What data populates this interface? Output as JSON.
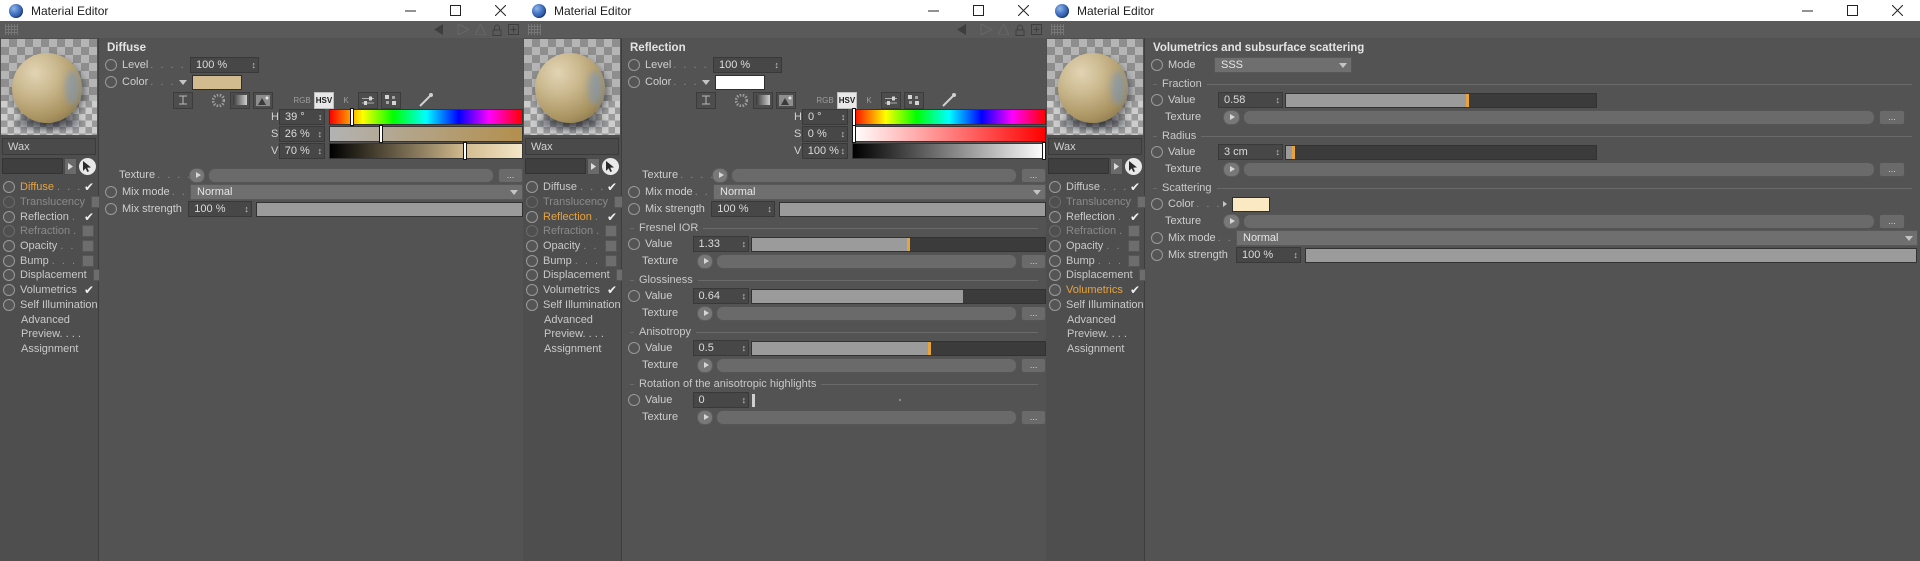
{
  "app": {
    "title": "Material Editor"
  },
  "window_controls": {
    "minimize": "minimize-icon",
    "maximize": "maximize-icon",
    "close": "close-icon"
  },
  "material": {
    "name": "Wax"
  },
  "channels": [
    {
      "label": "Diffuse",
      "dots": ". . . . . . . .",
      "checked": true,
      "enabled": true,
      "active": false
    },
    {
      "label": "Translucency",
      "dots": ". . .",
      "checked": false,
      "enabled": false,
      "active": false
    },
    {
      "label": "Reflection",
      "dots": ". . . . .",
      "checked": true,
      "enabled": true,
      "active": false
    },
    {
      "label": "Refraction",
      "dots": ". . . . .",
      "checked": false,
      "enabled": false,
      "active": false
    },
    {
      "label": "Opacity",
      "dots": ". . . . . . . .",
      "checked": false,
      "enabled": true,
      "active": false
    },
    {
      "label": "Bump",
      "dots": ". . . . . . . .",
      "checked": false,
      "enabled": true,
      "active": false
    },
    {
      "label": "Displacement",
      "dots": ". . .",
      "checked": false,
      "enabled": true,
      "active": false
    },
    {
      "label": "Volumetrics",
      "dots": ". . . .",
      "checked": true,
      "enabled": true,
      "active": false
    },
    {
      "label": "Self Illumination",
      "dots": "",
      "checked": false,
      "enabled": true,
      "active": false
    }
  ],
  "extra_items": [
    "Advanced",
    "Preview. . . .",
    "Assignment"
  ],
  "panels": {
    "diffuse": {
      "active_channel": "Diffuse",
      "section_title": "Diffuse",
      "level": {
        "label": "Level",
        "dots": ". . . . . . .",
        "value": "100 %"
      },
      "color": {
        "label": "Color",
        "dots": ". . .",
        "swatch": "#d2bb8e"
      },
      "color_mode": {
        "rgb": "RGB",
        "hsv": "HSV",
        "k": "K",
        "selected": "HSV"
      },
      "hsv": [
        {
          "label": "H",
          "value": "39 °",
          "pos_pct": 11
        },
        {
          "label": "S",
          "value": "26 %",
          "pos_pct": 26
        },
        {
          "label": "V",
          "value": "70 %",
          "pos_pct": 70
        }
      ],
      "texture": {
        "label": "Texture",
        "dots": ". . . . ."
      },
      "mix_mode": {
        "label": "Mix mode",
        "dots": ". . .",
        "value": "Normal"
      },
      "mix_strength": {
        "label": "Mix strength",
        "value": "100 %",
        "fill_pct": 100
      }
    },
    "reflection": {
      "active_channel": "Reflection",
      "section_title": "Reflection",
      "level": {
        "label": "Level",
        "dots": ". . . . . . .",
        "value": "100 %"
      },
      "color": {
        "label": "Color",
        "dots": ". . .",
        "swatch": "#ffffff"
      },
      "color_mode": {
        "rgb": "RGB",
        "hsv": "HSV",
        "k": "K",
        "selected": "HSV"
      },
      "hsv": [
        {
          "label": "H",
          "value": "0 °",
          "pos_pct": 0
        },
        {
          "label": "S",
          "value": "0 %",
          "pos_pct": 0
        },
        {
          "label": "V",
          "value": "100 %",
          "pos_pct": 100
        }
      ],
      "texture": {
        "label": "Texture",
        "dots": ". . . . ."
      },
      "mix_mode": {
        "label": "Mix mode",
        "dots": ". . .",
        "value": "Normal"
      },
      "mix_strength": {
        "label": "Mix strength",
        "value": "100 %",
        "fill_pct": 100
      },
      "groups": [
        {
          "title": "Fresnel IOR",
          "value_label": "Value",
          "value": "1.33",
          "fill_pct": 53,
          "texture_label": "Texture"
        },
        {
          "title": "Glossiness",
          "value_label": "Value",
          "value": "0.64",
          "fill_pct": 72,
          "texture_label": "Texture"
        },
        {
          "title": "Anisotropy",
          "value_label": "Value",
          "value": "0.5",
          "fill_pct": 60,
          "texture_label": "Texture"
        },
        {
          "title": "Rotation of the anisotropic highlights",
          "value_label": "Value",
          "value": "0",
          "fill_pct": 0,
          "texture_label": "Texture"
        }
      ]
    },
    "volumetrics": {
      "active_channel": "Volumetrics",
      "section_title": "Volumetrics and subsurface scattering",
      "mode": {
        "label": "Mode",
        "value": "SSS"
      },
      "fraction": {
        "title": "Fraction",
        "value_label": "Value",
        "value": "0.58",
        "fill_pct": 58,
        "texture_label": "Texture"
      },
      "radius": {
        "title": "Radius",
        "value_label": "Value",
        "value": "3 cm",
        "fill_pct": 2,
        "texture_label": "Texture"
      },
      "scattering": {
        "title": "Scattering",
        "color": {
          "label": "Color",
          "dots": ". . .",
          "swatch": "#fbe9c4"
        },
        "texture_label": "Texture",
        "mix_mode": {
          "label": "Mix mode",
          "dots": ". . .",
          "value": "Normal"
        },
        "mix_strength": {
          "label": "Mix strength",
          "value": "100 %",
          "fill_pct": 100
        }
      }
    }
  },
  "colors": {
    "accent": "#e8a33d",
    "panel_bg": "#535353",
    "sidebar_bg": "#4e4e4e",
    "titlebar_bg": "#ffffff"
  }
}
